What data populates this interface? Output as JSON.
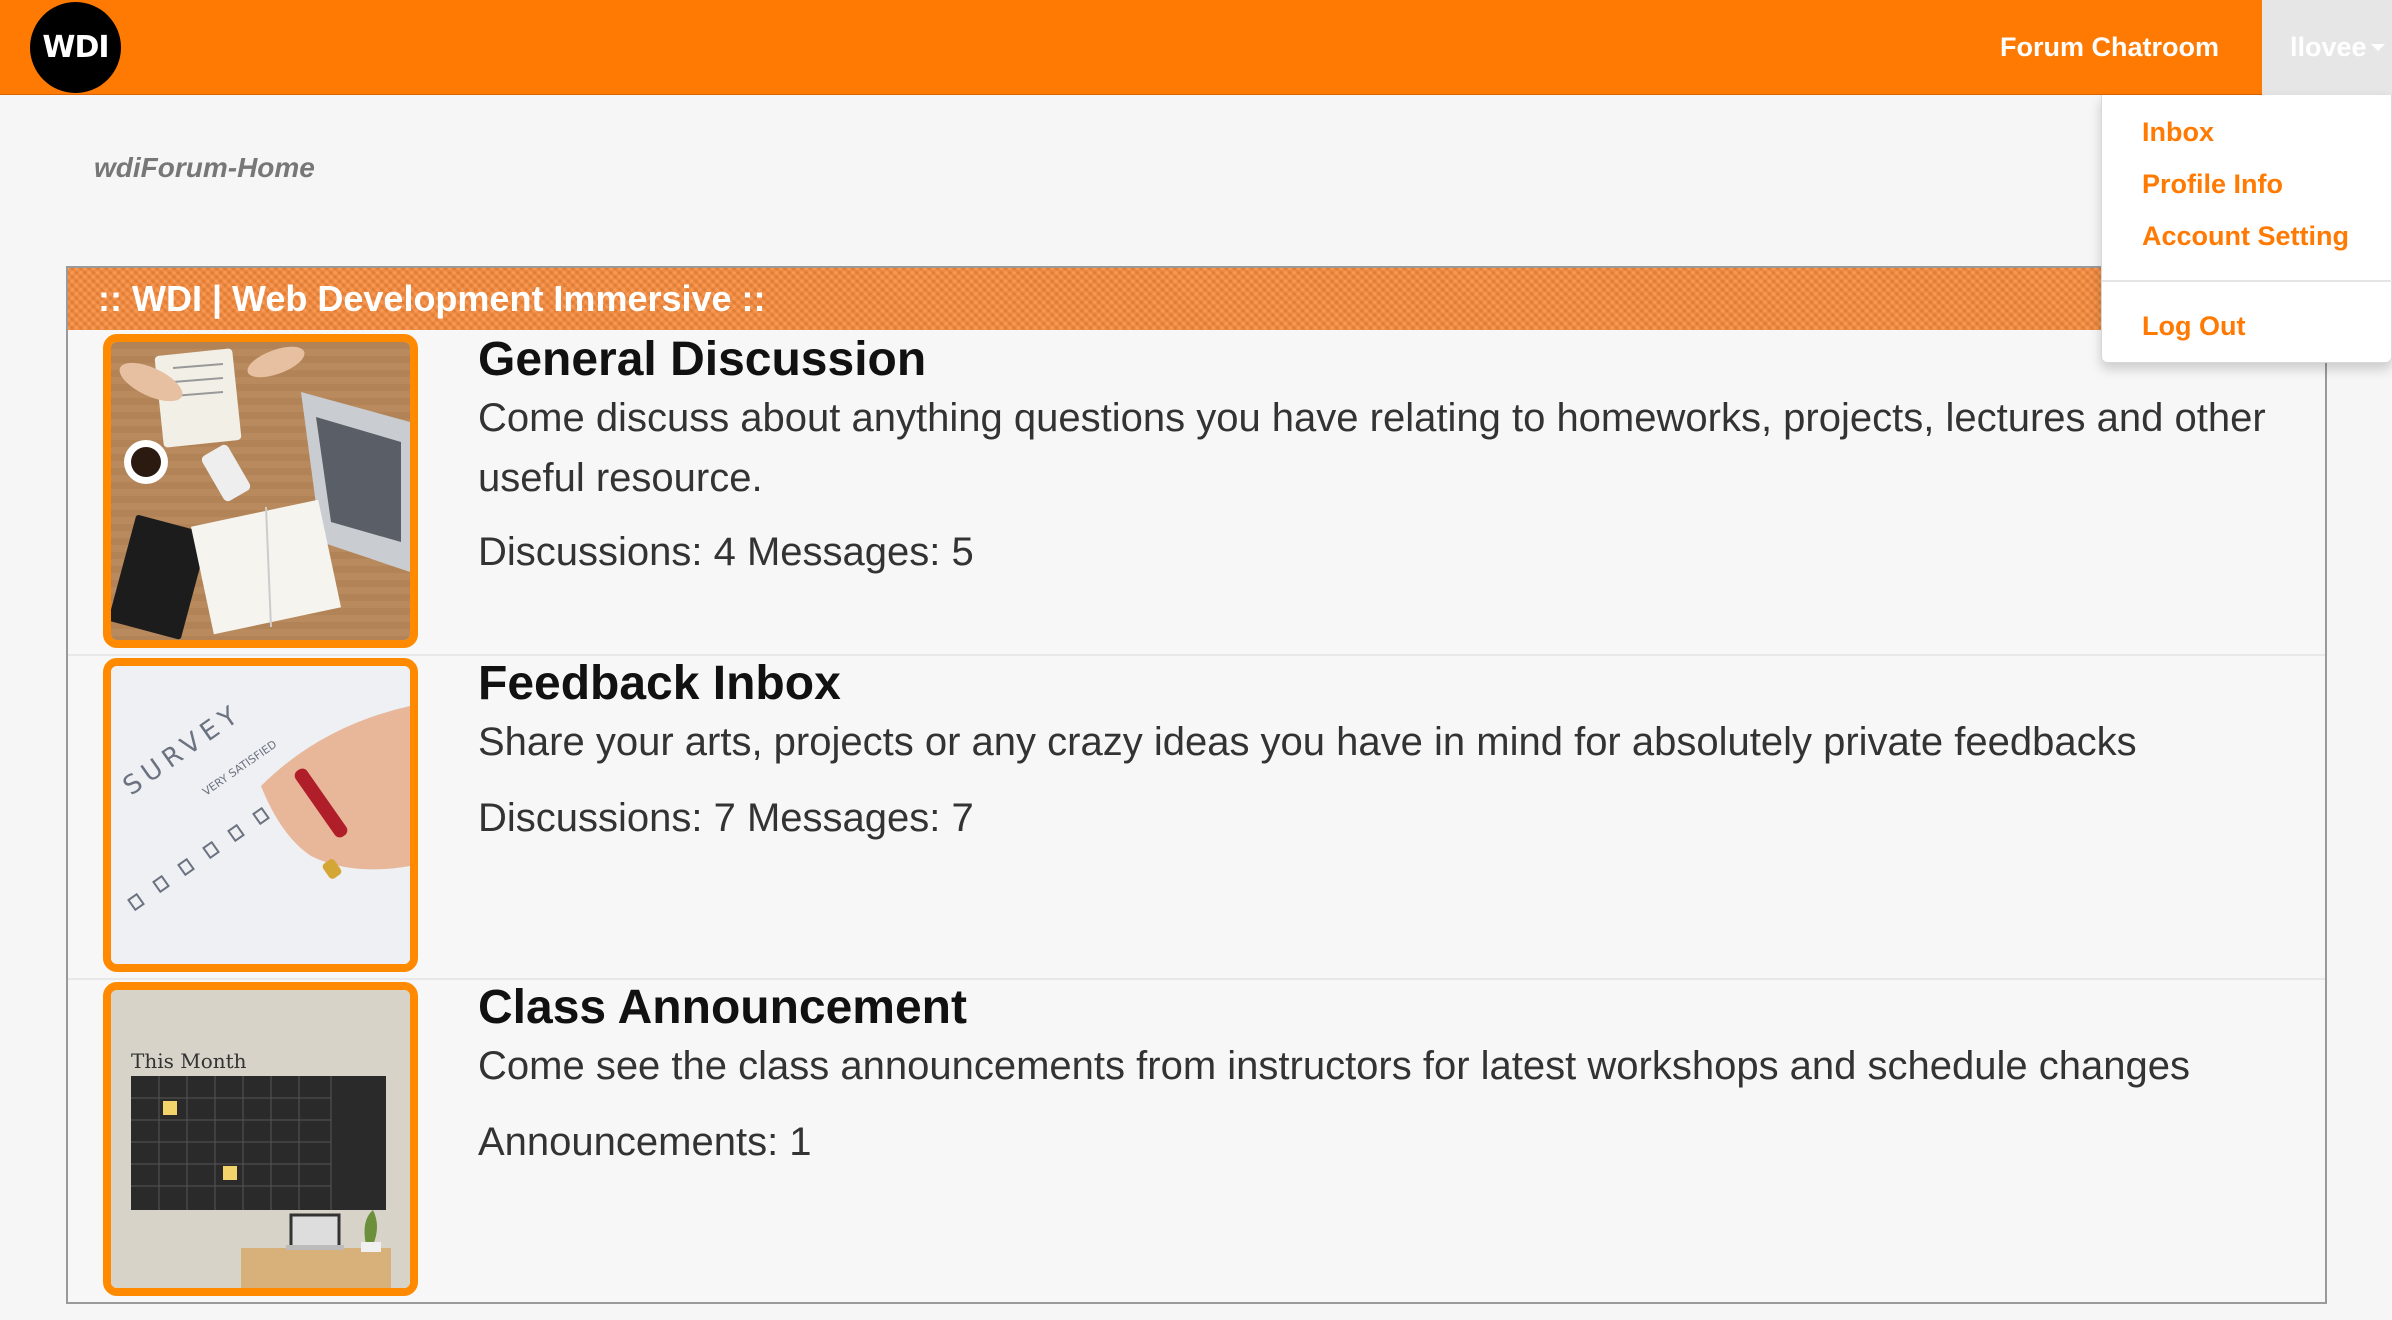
{
  "brand": {
    "logo_text": "WDI"
  },
  "nav": {
    "chatroom_label": "Forum Chatroom",
    "user_label": "llovee"
  },
  "user_menu": {
    "items": [
      "Inbox",
      "Profile Info",
      "Account Setting"
    ],
    "logout_label": "Log Out"
  },
  "breadcrumb": "wdiForum-Home",
  "panel": {
    "title": ":: WDI | Web Development Immersive ::",
    "forums": [
      {
        "title": "General Discussion",
        "description": "Come discuss about anything questions you have relating to homeworks, projects, lectures and other useful resource.",
        "stats": "Discussions: 4 Messages: 5",
        "image": "desk-workspace-photo"
      },
      {
        "title": "Feedback Inbox",
        "description": "Share your arts, projects or any crazy ideas you have in mind for absolutely private feedbacks",
        "stats": "Discussions: 7 Messages: 7",
        "image": "survey-form-photo",
        "survey_text": "SURVEY",
        "survey_subtext": "VERY SATISFIED"
      },
      {
        "title": "Class Announcement",
        "description": "Come see the class announcements from instructors for latest workshops and schedule changes",
        "stats": "Announcements: 1",
        "image": "calendar-wall-photo",
        "calendar_text": "This Month"
      }
    ]
  },
  "colors": {
    "brand_orange": "#ff7a03",
    "thumb_border": "#ff8a00",
    "header_orange": "#f7893a"
  }
}
